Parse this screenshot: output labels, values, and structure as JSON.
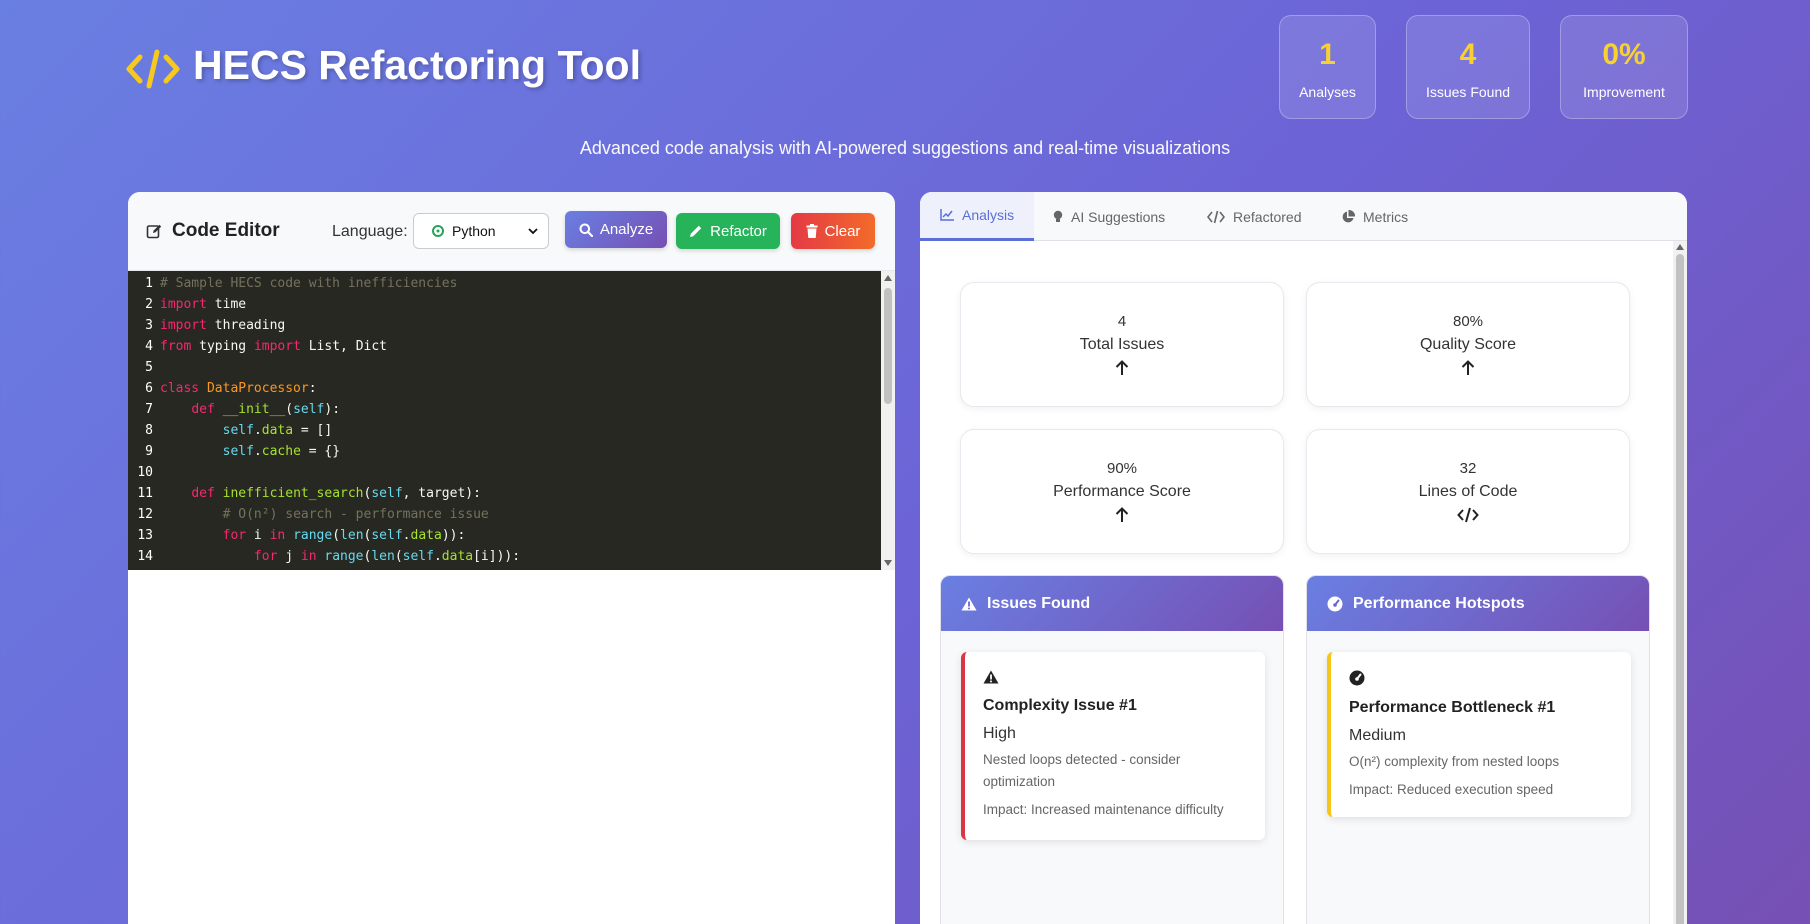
{
  "header": {
    "title": "HECS Refactoring Tool",
    "subtitle": "Advanced code analysis with AI-powered suggestions and real-time visualizations",
    "logo_icon": "code-icon",
    "stats": [
      {
        "value": "1",
        "label": "Analyses"
      },
      {
        "value": "4",
        "label": "Issues Found"
      },
      {
        "value": "0%",
        "label": "Improvement"
      }
    ]
  },
  "editor": {
    "title": "Code Editor",
    "language_label": "Language:",
    "language_value": "Python",
    "buttons": {
      "analyze": "Analyze",
      "refactor": "Refactor",
      "clear": "Clear"
    },
    "lines": [
      [
        [
          "com",
          "# Sample HECS code with inefficiencies"
        ]
      ],
      [
        [
          "kw",
          "import"
        ],
        [
          "",
          " time"
        ]
      ],
      [
        [
          "kw",
          "import"
        ],
        [
          "",
          " threading"
        ]
      ],
      [
        [
          "kw",
          "from"
        ],
        [
          "",
          " typing "
        ],
        [
          "kw",
          "import"
        ],
        [
          "",
          " List, Dict"
        ]
      ],
      [],
      [
        [
          "kw",
          "class"
        ],
        [
          "",
          " "
        ],
        [
          "cls",
          "DataProcessor"
        ],
        [
          "",
          ":"
        ]
      ],
      [
        [
          "",
          "    "
        ],
        [
          "kw",
          "def"
        ],
        [
          "",
          " "
        ],
        [
          "fn",
          "__init__"
        ],
        [
          "",
          "("
        ],
        [
          "self",
          "self"
        ],
        [
          "",
          "):"
        ]
      ],
      [
        [
          "",
          "        "
        ],
        [
          "self",
          "self"
        ],
        [
          "",
          "."
        ],
        [
          "attr",
          "data"
        ],
        [
          "",
          " = []"
        ]
      ],
      [
        [
          "",
          "        "
        ],
        [
          "self",
          "self"
        ],
        [
          "",
          "."
        ],
        [
          "attr",
          "cache"
        ],
        [
          "",
          " = {}"
        ]
      ],
      [],
      [
        [
          "",
          "    "
        ],
        [
          "kw",
          "def"
        ],
        [
          "",
          " "
        ],
        [
          "fn",
          "inefficient_search"
        ],
        [
          "",
          "("
        ],
        [
          "self",
          "self"
        ],
        [
          "",
          ", target):"
        ]
      ],
      [
        [
          "",
          "        "
        ],
        [
          "com",
          "# O(n²) search - performance issue"
        ]
      ],
      [
        [
          "",
          "        "
        ],
        [
          "kw",
          "for"
        ],
        [
          "",
          " i "
        ],
        [
          "kw",
          "in"
        ],
        [
          "",
          " "
        ],
        [
          "bi",
          "range"
        ],
        [
          "",
          "("
        ],
        [
          "bi",
          "len"
        ],
        [
          "",
          "("
        ],
        [
          "self",
          "self"
        ],
        [
          "",
          "."
        ],
        [
          "attr",
          "data"
        ],
        [
          "",
          ")):"
        ]
      ],
      [
        [
          "",
          "            "
        ],
        [
          "kw",
          "for"
        ],
        [
          "",
          " j "
        ],
        [
          "kw",
          "in"
        ],
        [
          "",
          " "
        ],
        [
          "bi",
          "range"
        ],
        [
          "",
          "("
        ],
        [
          "bi",
          "len"
        ],
        [
          "",
          "("
        ],
        [
          "self",
          "self"
        ],
        [
          "",
          "."
        ],
        [
          "attr",
          "data"
        ],
        [
          "",
          "[i])):"
        ]
      ]
    ]
  },
  "results": {
    "tabs": [
      {
        "label": "Analysis",
        "icon": "line-chart-icon",
        "active": true
      },
      {
        "label": "AI Suggestions",
        "icon": "lightbulb-icon",
        "active": false
      },
      {
        "label": "Refactored",
        "icon": "code-icon",
        "active": false
      },
      {
        "label": "Metrics",
        "icon": "pie-chart-icon",
        "active": false
      }
    ],
    "metrics": [
      {
        "value": "4",
        "label": "Total Issues",
        "icon": "arrow-up-icon"
      },
      {
        "value": "80%",
        "label": "Quality Score",
        "icon": "arrow-up-icon"
      },
      {
        "value": "90%",
        "label": "Performance Score",
        "icon": "arrow-up-icon"
      },
      {
        "value": "32",
        "label": "Lines of Code",
        "icon": "code-icon"
      }
    ],
    "issues_section": {
      "title": "Issues Found",
      "icon": "warning-icon",
      "items": [
        {
          "title": "Complexity Issue #1",
          "severity": "High",
          "description": "Nested loops detected - consider optimization",
          "impact": "Impact: Increased maintenance difficulty",
          "color": "#dc3545"
        }
      ]
    },
    "hotspots_section": {
      "title": "Performance Hotspots",
      "icon": "gauge-icon",
      "items": [
        {
          "title": "Performance Bottleneck #1",
          "severity": "Medium",
          "description": "O(n²) complexity from nested loops",
          "impact": "Impact: Reduced execution speed",
          "color": "#f5c518"
        }
      ]
    }
  }
}
